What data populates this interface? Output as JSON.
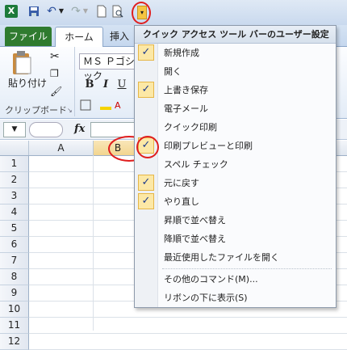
{
  "qat": {
    "buttons": [
      "excel-app-icon",
      "save-icon",
      "undo-icon",
      "undo-dropdown-icon",
      "redo-icon",
      "redo-dropdown-icon",
      "new-icon",
      "print-preview-icon",
      "customize-qat-icon"
    ]
  },
  "tabs": {
    "file": "ファイル",
    "home": "ホーム",
    "insert": "挿入"
  },
  "ribbon": {
    "paste_label": "貼り付け",
    "clipboard_group": "クリップボード",
    "font_name": "ＭＳ Ｐゴシック",
    "bold": "B",
    "italic": "I",
    "underline": "U"
  },
  "formula_bar": {
    "fx": "fx"
  },
  "sheet": {
    "columns": [
      "A",
      "B"
    ],
    "rows": [
      "1",
      "2",
      "3",
      "4",
      "5",
      "6",
      "7",
      "8",
      "9",
      "10",
      "11",
      "12"
    ]
  },
  "menu": {
    "title": "クイック アクセス ツール バーのユーザー設定",
    "items": [
      {
        "label": "新規作成",
        "checked": true
      },
      {
        "label": "開く",
        "checked": false
      },
      {
        "label": "上書き保存",
        "checked": true
      },
      {
        "label": "電子メール",
        "checked": false
      },
      {
        "label": "クイック印刷",
        "checked": false
      },
      {
        "label": "印刷プレビューと印刷",
        "checked": true
      },
      {
        "label": "スペル チェック",
        "checked": false
      },
      {
        "label": "元に戻す",
        "checked": true
      },
      {
        "label": "やり直し",
        "checked": true
      },
      {
        "label": "昇順で並べ替え",
        "checked": false
      },
      {
        "label": "降順で並べ替え",
        "checked": false
      },
      {
        "label": "最近使用したファイルを開く",
        "checked": false
      }
    ],
    "more_commands": "その他のコマンド(M)...",
    "show_below": "リボンの下に表示(S)"
  },
  "colors": {
    "file_tab": "#2f7b2f",
    "check_bg": "#fce8a6",
    "highlight_circle": "#e01e1e"
  }
}
